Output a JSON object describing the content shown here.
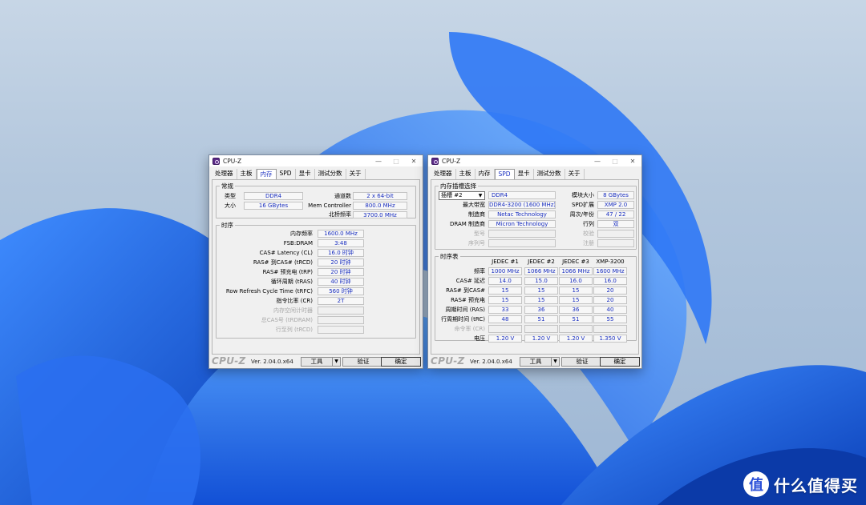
{
  "watermark": {
    "text": "什么值得买",
    "icon": "值"
  },
  "left_window": {
    "title": "CPU-Z",
    "tabs": [
      "处理器",
      "主板",
      "内存",
      "SPD",
      "显卡",
      "测试分数",
      "关于"
    ],
    "active_tab": "内存",
    "general": {
      "title": "常规",
      "type_label": "类型",
      "type_value": "DDR4",
      "size_label": "大小",
      "size_value": "16 GBytes",
      "channel_label": "通道数",
      "channel_value": "2 x 64-bit",
      "memctrl_label": "Mem Controller",
      "memctrl_value": "800.0 MHz",
      "nb_label": "北桥频率",
      "nb_value": "3700.0 MHz"
    },
    "timings": {
      "title": "时序",
      "rows": [
        {
          "label": "内存频率",
          "value": "1600.0 MHz",
          "dim": false
        },
        {
          "label": "FSB:DRAM",
          "value": "3:48",
          "dim": false
        },
        {
          "label": "CAS# Latency (CL)",
          "value": "16.0 时钟",
          "dim": false
        },
        {
          "label": "RAS# 到CAS# (tRCD)",
          "value": "20 时钟",
          "dim": false
        },
        {
          "label": "RAS# 预充电 (tRP)",
          "value": "20 时钟",
          "dim": false
        },
        {
          "label": "循环周期 (tRAS)",
          "value": "40 时钟",
          "dim": false
        },
        {
          "label": "Row Refresh Cycle Time (tRFC)",
          "value": "560 时钟",
          "dim": false
        },
        {
          "label": "指令比率 (CR)",
          "value": "2T",
          "dim": false
        },
        {
          "label": "内存空闲计时器",
          "value": "",
          "dim": true
        },
        {
          "label": "总CAS号 (tRDRAM)",
          "value": "",
          "dim": true
        },
        {
          "label": "行至列 (tRCD)",
          "value": "",
          "dim": true
        }
      ]
    },
    "footer": {
      "brand": "CPU-Z",
      "version": "Ver. 2.04.0.x64",
      "tools": "工具",
      "validate": "验证",
      "ok": "确定"
    }
  },
  "right_window": {
    "title": "CPU-Z",
    "tabs": [
      "处理器",
      "主板",
      "内存",
      "SPD",
      "显卡",
      "测试分数",
      "关于"
    ],
    "active_tab": "SPD",
    "slot": {
      "title": "内存插槽选择",
      "selected": "插槽 #2",
      "type_value": "DDR4",
      "module_size_label": "模块大小",
      "module_size_value": "8 GBytes",
      "max_bw_label": "最大带宽",
      "max_bw_value": "DDR4-3200 (1600 MHz)",
      "spd_ext_label": "SPD扩展",
      "spd_ext_value": "XMP 2.0",
      "maker_label": "制造商",
      "maker_value": "Netac Technology",
      "week_label": "周次/年份",
      "week_value": "47 / 22",
      "dram_maker_label": "DRAM 制造商",
      "dram_maker_value": "Micron Technology",
      "rank_label": "行列",
      "rank_value": "双",
      "model_label": "型号",
      "check_label": "校验",
      "serial_label": "序列号",
      "reg_label": "注册"
    },
    "timing_table": {
      "title": "时序表",
      "columns": [
        "JEDEC #1",
        "JEDEC #2",
        "JEDEC #3",
        "XMP-3200"
      ],
      "rows": [
        {
          "label": "频率",
          "values": [
            "1000 MHz",
            "1066 MHz",
            "1066 MHz",
            "1600 MHz"
          ],
          "dim": false
        },
        {
          "label": "CAS# 延迟",
          "values": [
            "14.0",
            "15.0",
            "16.0",
            "16.0"
          ],
          "dim": false
        },
        {
          "label": "RAS# 到CAS#",
          "values": [
            "15",
            "15",
            "15",
            "20"
          ],
          "dim": false
        },
        {
          "label": "RAS# 预充电",
          "values": [
            "15",
            "15",
            "15",
            "20"
          ],
          "dim": false
        },
        {
          "label": "周期时间 (RAS)",
          "values": [
            "33",
            "36",
            "36",
            "40"
          ],
          "dim": false
        },
        {
          "label": "行周期时间 (tRC)",
          "values": [
            "48",
            "51",
            "51",
            "55"
          ],
          "dim": false
        },
        {
          "label": "命令率 (CR)",
          "values": [
            "",
            "",
            "",
            ""
          ],
          "dim": true
        },
        {
          "label": "电压",
          "values": [
            "1.20 V",
            "1.20 V",
            "1.20 V",
            "1.350 V"
          ],
          "dim": false
        }
      ]
    },
    "footer": {
      "brand": "CPU-Z",
      "version": "Ver. 2.04.0.x64",
      "tools": "工具",
      "validate": "验证",
      "ok": "确定"
    }
  }
}
